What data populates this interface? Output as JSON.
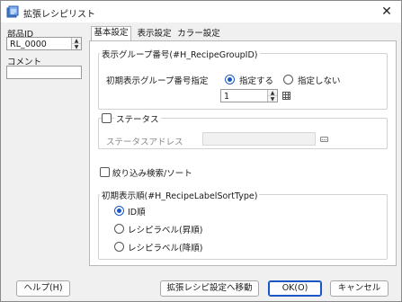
{
  "window": {
    "title": "拡張レシピリスト",
    "close_glyph": "✕"
  },
  "left": {
    "part_id_label": "部品ID",
    "part_id_value": "RL_0000",
    "comment_label": "コメント",
    "comment_value": ""
  },
  "tabs": [
    {
      "label": "基本設定",
      "active": true
    },
    {
      "label": "表示設定",
      "active": false
    },
    {
      "label": "カラー設定",
      "active": false
    }
  ],
  "group_number": {
    "title": "表示グループ番号(#H_RecipeGroupID)",
    "initial_label": "初期表示グループ番号指定",
    "option_specify": "指定する",
    "option_no_specify": "指定しない",
    "number_value": "1"
  },
  "status": {
    "label": "ステータス",
    "address_label": "ステータスアドレス",
    "address_value": ""
  },
  "filter": {
    "label": "絞り込み検索/ソート"
  },
  "sort_group": {
    "title": "初期表示順(#H_RecipeLabelSortType)",
    "option_id": "ID順",
    "option_label_asc": "レシピラベル(昇順)",
    "option_label_desc": "レシピラベル(降順)"
  },
  "buttons": {
    "help": "ヘルプ(H)",
    "goto_ext": "拡張レシピ設定へ移動",
    "ok": "OK(O)",
    "cancel": "キャンセル"
  },
  "colors": {
    "accent": "#1a56c4"
  }
}
